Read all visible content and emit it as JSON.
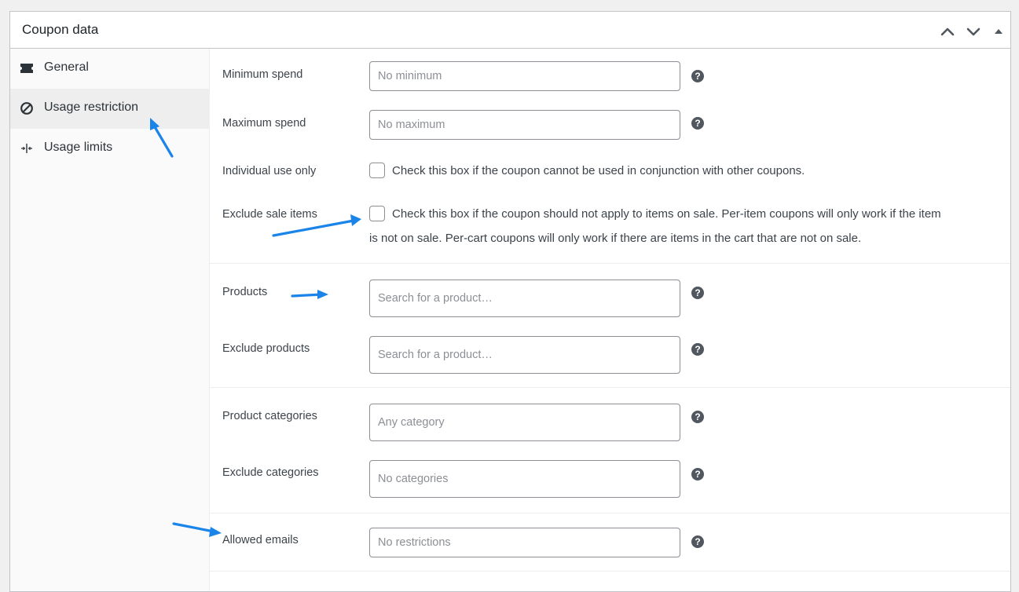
{
  "panel": {
    "title": "Coupon data",
    "controls": [
      "chevron-up-icon",
      "chevron-down-icon",
      "triangle-up-icon"
    ]
  },
  "tabs": [
    {
      "label": "General",
      "icon": "ticket-icon",
      "active": false
    },
    {
      "label": "Usage restriction",
      "icon": "block-icon",
      "active": true
    },
    {
      "label": "Usage limits",
      "icon": "arrows-inward-icon",
      "active": false
    }
  ],
  "fields": {
    "minimum_spend": {
      "label": "Minimum spend",
      "placeholder": "No minimum"
    },
    "maximum_spend": {
      "label": "Maximum spend",
      "placeholder": "No maximum"
    },
    "individual_use": {
      "label": "Individual use only",
      "description": "Check this box if the coupon cannot be used in conjunction with other coupons."
    },
    "exclude_sale": {
      "label": "Exclude sale items",
      "description_line1": "Check this box if the coupon should not apply to items on sale. Per-item coupons will only work if the item",
      "description_line2": "is not on sale. Per-cart coupons will only work if there are items in the cart that are not on sale."
    },
    "products": {
      "label": "Products",
      "placeholder": "Search for a product…"
    },
    "exclude_products": {
      "label": "Exclude products",
      "placeholder": "Search for a product…"
    },
    "product_categories": {
      "label": "Product categories",
      "placeholder": "Any category"
    },
    "exclude_categories": {
      "label": "Exclude categories",
      "placeholder": "No categories"
    },
    "allowed_emails": {
      "label": "Allowed emails",
      "placeholder": "No restrictions"
    }
  },
  "colors": {
    "annotation_arrow": "#1a84e8",
    "help_icon": "#50575e",
    "active_tab": "#eeeeee"
  }
}
